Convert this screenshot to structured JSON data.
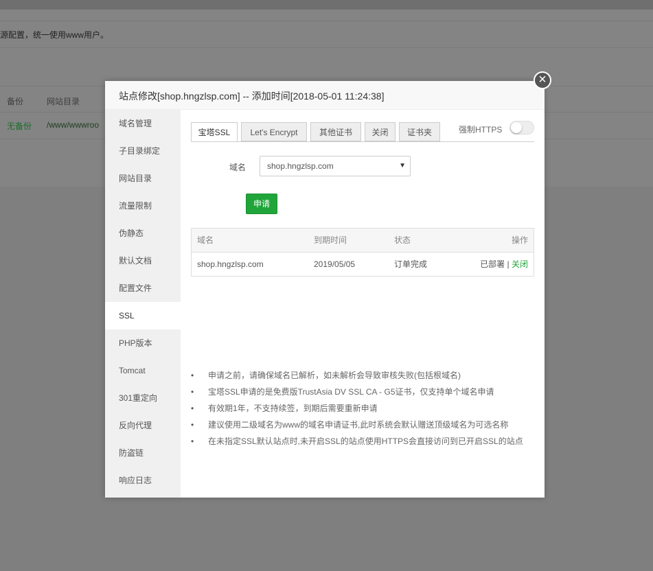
{
  "background": {
    "notice": "源配置，统一使用www用户。",
    "headers": [
      "备份",
      "网站目录"
    ],
    "row": {
      "backup": "无备份",
      "dir": "/www/wwwroo"
    }
  },
  "modal": {
    "title": "站点修改[shop.hngzlsp.com] -- 添加时间[2018-05-01 11:24:38]",
    "close_icon": "×"
  },
  "sidebar": {
    "items": [
      {
        "label": "域名管理"
      },
      {
        "label": "子目录绑定"
      },
      {
        "label": "网站目录"
      },
      {
        "label": "流量限制"
      },
      {
        "label": "伪静态"
      },
      {
        "label": "默认文档"
      },
      {
        "label": "配置文件"
      },
      {
        "label": "SSL"
      },
      {
        "label": "PHP版本"
      },
      {
        "label": "Tomcat"
      },
      {
        "label": "301重定向"
      },
      {
        "label": "反向代理"
      },
      {
        "label": "防盗链"
      },
      {
        "label": "响应日志"
      }
    ],
    "active_index": 7
  },
  "ssl": {
    "tabs": [
      "宝塔SSL",
      "Let's Encrypt",
      "其他证书",
      "关闭",
      "证书夹"
    ],
    "active_tab": 0,
    "force_https_label": "强制HTTPS",
    "force_https_on": false,
    "domain_label": "域名",
    "domain_value": "shop.hngzlsp.com",
    "apply_label": "申请",
    "table": {
      "headers": [
        "域名",
        "到期时间",
        "状态",
        "操作"
      ],
      "rows": [
        {
          "domain": "shop.hngzlsp.com",
          "expire": "2019/05/05",
          "status": "订单完成",
          "deployed": "已部署",
          "sep": "|",
          "close": "关闭"
        }
      ]
    },
    "notes": [
      "申请之前，请确保域名已解析，如未解析会导致审核失败(包括根域名)",
      "宝塔SSL申请的是免费版TrustAsia DV SSL CA - G5证书，仅支持单个域名申请",
      "有效期1年，不支持续签，到期后需要重新申请",
      "建议使用二级域名为www的域名申请证书,此时系统会默认赠送顶级域名为可选名称",
      "在未指定SSL默认站点时,未开启SSL的站点使用HTTPS会直接访问到已开启SSL的站点"
    ],
    "bullet": "•"
  },
  "colors": {
    "accent": "#20a53a",
    "overlay": "#7f7f7f"
  }
}
